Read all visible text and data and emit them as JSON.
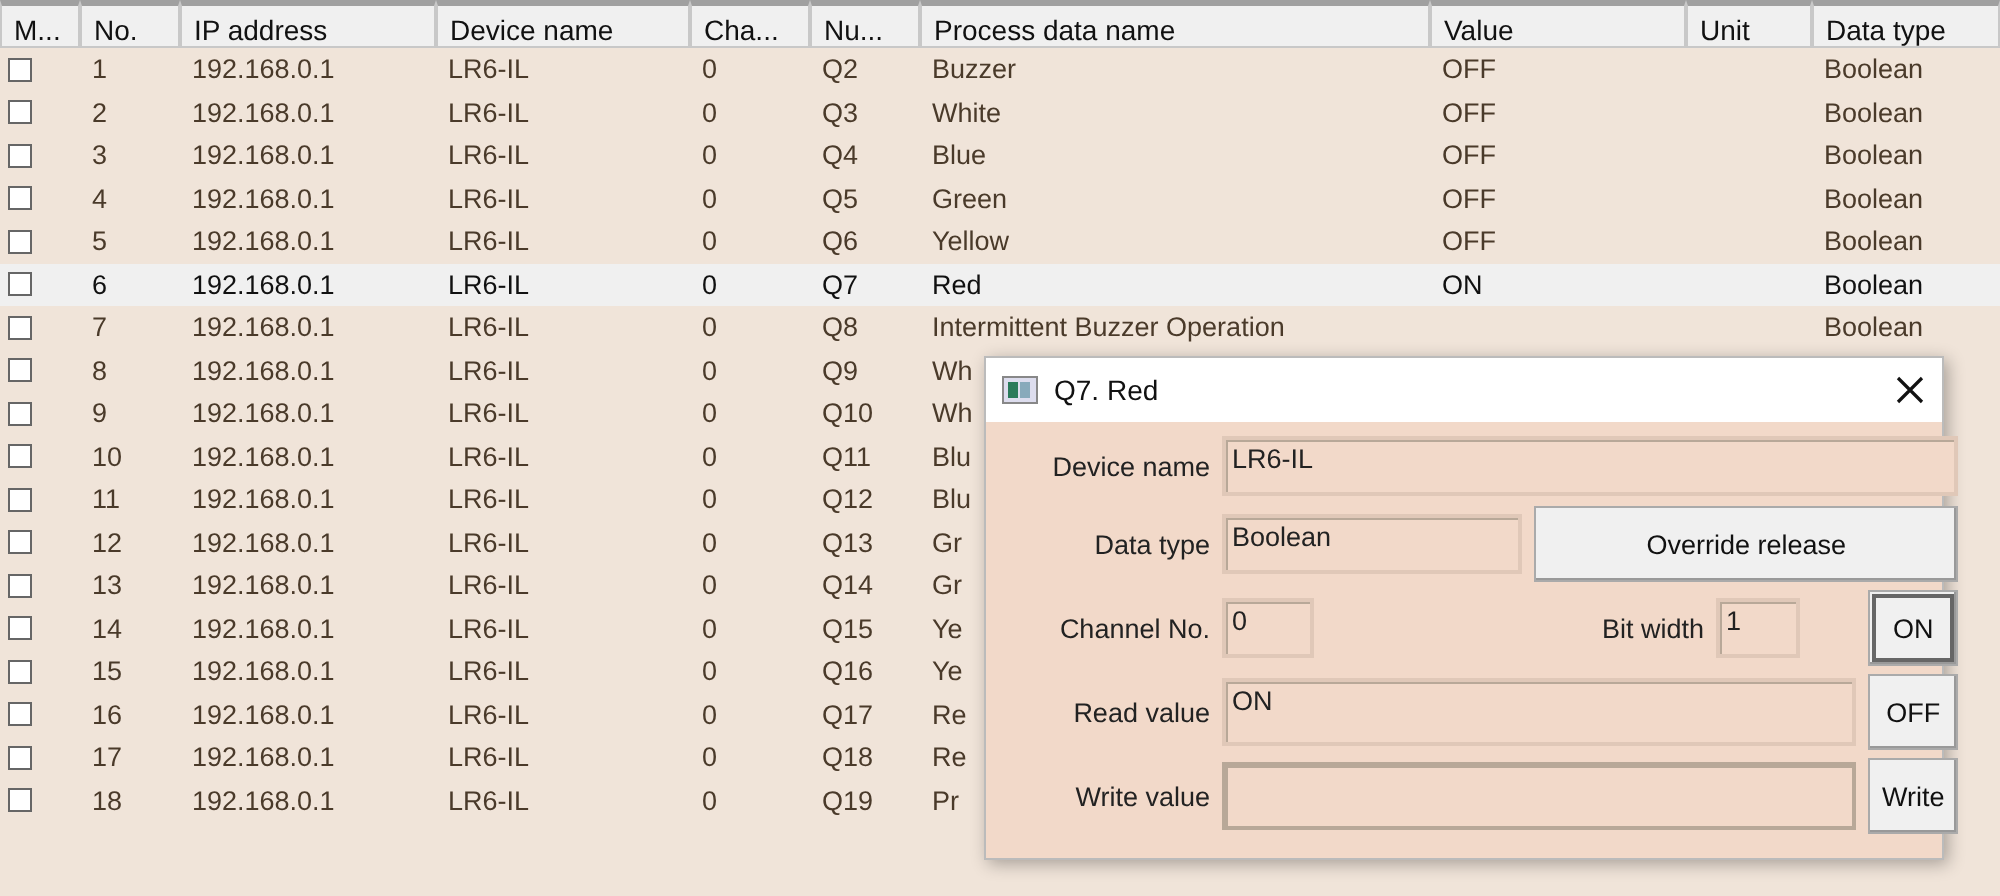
{
  "table": {
    "columns": [
      "M...",
      "No.",
      "IP address",
      "Device name",
      "Cha...",
      "Nu...",
      "Process data name",
      "Value",
      "Unit",
      "Data type"
    ],
    "rows": [
      {
        "checked": false,
        "selected": false,
        "no": "1",
        "ip": "192.168.0.1",
        "device": "LR6-IL",
        "channel": "0",
        "number": "Q2",
        "name": "Buzzer",
        "value": "OFF",
        "data_type": "Boolean"
      },
      {
        "checked": false,
        "selected": false,
        "no": "2",
        "ip": "192.168.0.1",
        "device": "LR6-IL",
        "channel": "0",
        "number": "Q3",
        "name": "White",
        "value": "OFF",
        "data_type": "Boolean"
      },
      {
        "checked": false,
        "selected": false,
        "no": "3",
        "ip": "192.168.0.1",
        "device": "LR6-IL",
        "channel": "0",
        "number": "Q4",
        "name": "Blue",
        "value": "OFF",
        "data_type": "Boolean"
      },
      {
        "checked": false,
        "selected": false,
        "no": "4",
        "ip": "192.168.0.1",
        "device": "LR6-IL",
        "channel": "0",
        "number": "Q5",
        "name": "Green",
        "value": "OFF",
        "data_type": "Boolean"
      },
      {
        "checked": false,
        "selected": false,
        "no": "5",
        "ip": "192.168.0.1",
        "device": "LR6-IL",
        "channel": "0",
        "number": "Q6",
        "name": "Yellow",
        "value": "OFF",
        "data_type": "Boolean"
      },
      {
        "checked": false,
        "selected": true,
        "no": "6",
        "ip": "192.168.0.1",
        "device": "LR6-IL",
        "channel": "0",
        "number": "Q7",
        "name": "Red",
        "value": "ON",
        "data_type": "Boolean"
      },
      {
        "checked": false,
        "selected": false,
        "no": "7",
        "ip": "192.168.0.1",
        "device": "LR6-IL",
        "channel": "0",
        "number": "Q8",
        "name": "Intermittent Buzzer Operation",
        "data_type": "Boolean"
      },
      {
        "checked": false,
        "selected": false,
        "no": "8",
        "ip": "192.168.0.1",
        "device": "LR6-IL",
        "channel": "0",
        "number": "Q9",
        "name": "Wh"
      },
      {
        "checked": false,
        "selected": false,
        "no": "9",
        "ip": "192.168.0.1",
        "device": "LR6-IL",
        "channel": "0",
        "number": "Q10",
        "name": "Wh"
      },
      {
        "checked": false,
        "selected": false,
        "no": "10",
        "ip": "192.168.0.1",
        "device": "LR6-IL",
        "channel": "0",
        "number": "Q11",
        "name": "Blu"
      },
      {
        "checked": false,
        "selected": false,
        "no": "11",
        "ip": "192.168.0.1",
        "device": "LR6-IL",
        "channel": "0",
        "number": "Q12",
        "name": "Blu"
      },
      {
        "checked": false,
        "selected": false,
        "no": "12",
        "ip": "192.168.0.1",
        "device": "LR6-IL",
        "channel": "0",
        "number": "Q13",
        "name": "Gr"
      },
      {
        "checked": false,
        "selected": false,
        "no": "13",
        "ip": "192.168.0.1",
        "device": "LR6-IL",
        "channel": "0",
        "number": "Q14",
        "name": "Gr"
      },
      {
        "checked": false,
        "selected": false,
        "no": "14",
        "ip": "192.168.0.1",
        "device": "LR6-IL",
        "channel": "0",
        "number": "Q15",
        "name": "Ye"
      },
      {
        "checked": false,
        "selected": false,
        "no": "15",
        "ip": "192.168.0.1",
        "device": "LR6-IL",
        "channel": "0",
        "number": "Q16",
        "name": "Ye"
      },
      {
        "checked": false,
        "selected": false,
        "no": "16",
        "ip": "192.168.0.1",
        "device": "LR6-IL",
        "channel": "0",
        "number": "Q17",
        "name": "Re"
      },
      {
        "checked": false,
        "selected": false,
        "no": "17",
        "ip": "192.168.0.1",
        "device": "LR6-IL",
        "channel": "0",
        "number": "Q18",
        "name": "Re"
      },
      {
        "checked": false,
        "selected": false,
        "no": "18",
        "ip": "192.168.0.1",
        "device": "LR6-IL",
        "channel": "0",
        "number": "Q19",
        "name": "Pr"
      }
    ]
  },
  "dialog": {
    "title": "Q7. Red",
    "device_name": {
      "label": "Device name",
      "value": "LR6-IL"
    },
    "data_type": {
      "label": "Data type",
      "value": "Boolean"
    },
    "override_button": "Override release",
    "channel_no": {
      "label": "Channel No.",
      "value": "0"
    },
    "bit_width": {
      "label": "Bit width",
      "value": "1"
    },
    "read_value": {
      "label": "Read value",
      "value": "ON"
    },
    "write_value": {
      "label": "Write value"
    },
    "buttons": [
      "ON",
      "OFF",
      "Write"
    ]
  }
}
